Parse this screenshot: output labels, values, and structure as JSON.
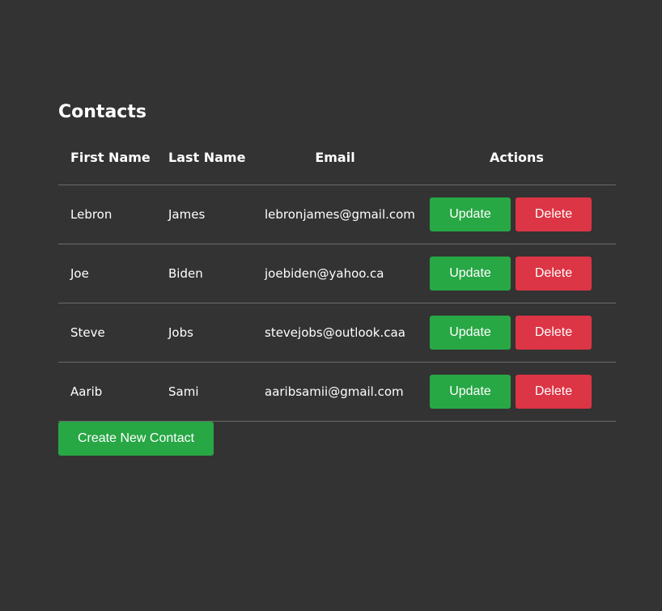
{
  "page": {
    "title": "Contacts"
  },
  "table": {
    "headers": {
      "first_name": "First Name",
      "last_name": "Last Name",
      "email": "Email",
      "actions": "Actions"
    },
    "rows": [
      {
        "first_name": "Lebron",
        "last_name": "James",
        "email": "lebronjames@gmail.com"
      },
      {
        "first_name": "Joe",
        "last_name": "Biden",
        "email": "joebiden@yahoo.ca"
      },
      {
        "first_name": "Steve",
        "last_name": "Jobs",
        "email": "stevejobs@outlook.caa"
      },
      {
        "first_name": "Aarib",
        "last_name": "Sami",
        "email": "aaribsamii@gmail.com"
      }
    ],
    "update_label": "Update",
    "delete_label": "Delete"
  },
  "create_button": {
    "label": "Create New Contact"
  },
  "colors": {
    "background": "#333333",
    "success": "#28a745",
    "danger": "#dc3545"
  }
}
